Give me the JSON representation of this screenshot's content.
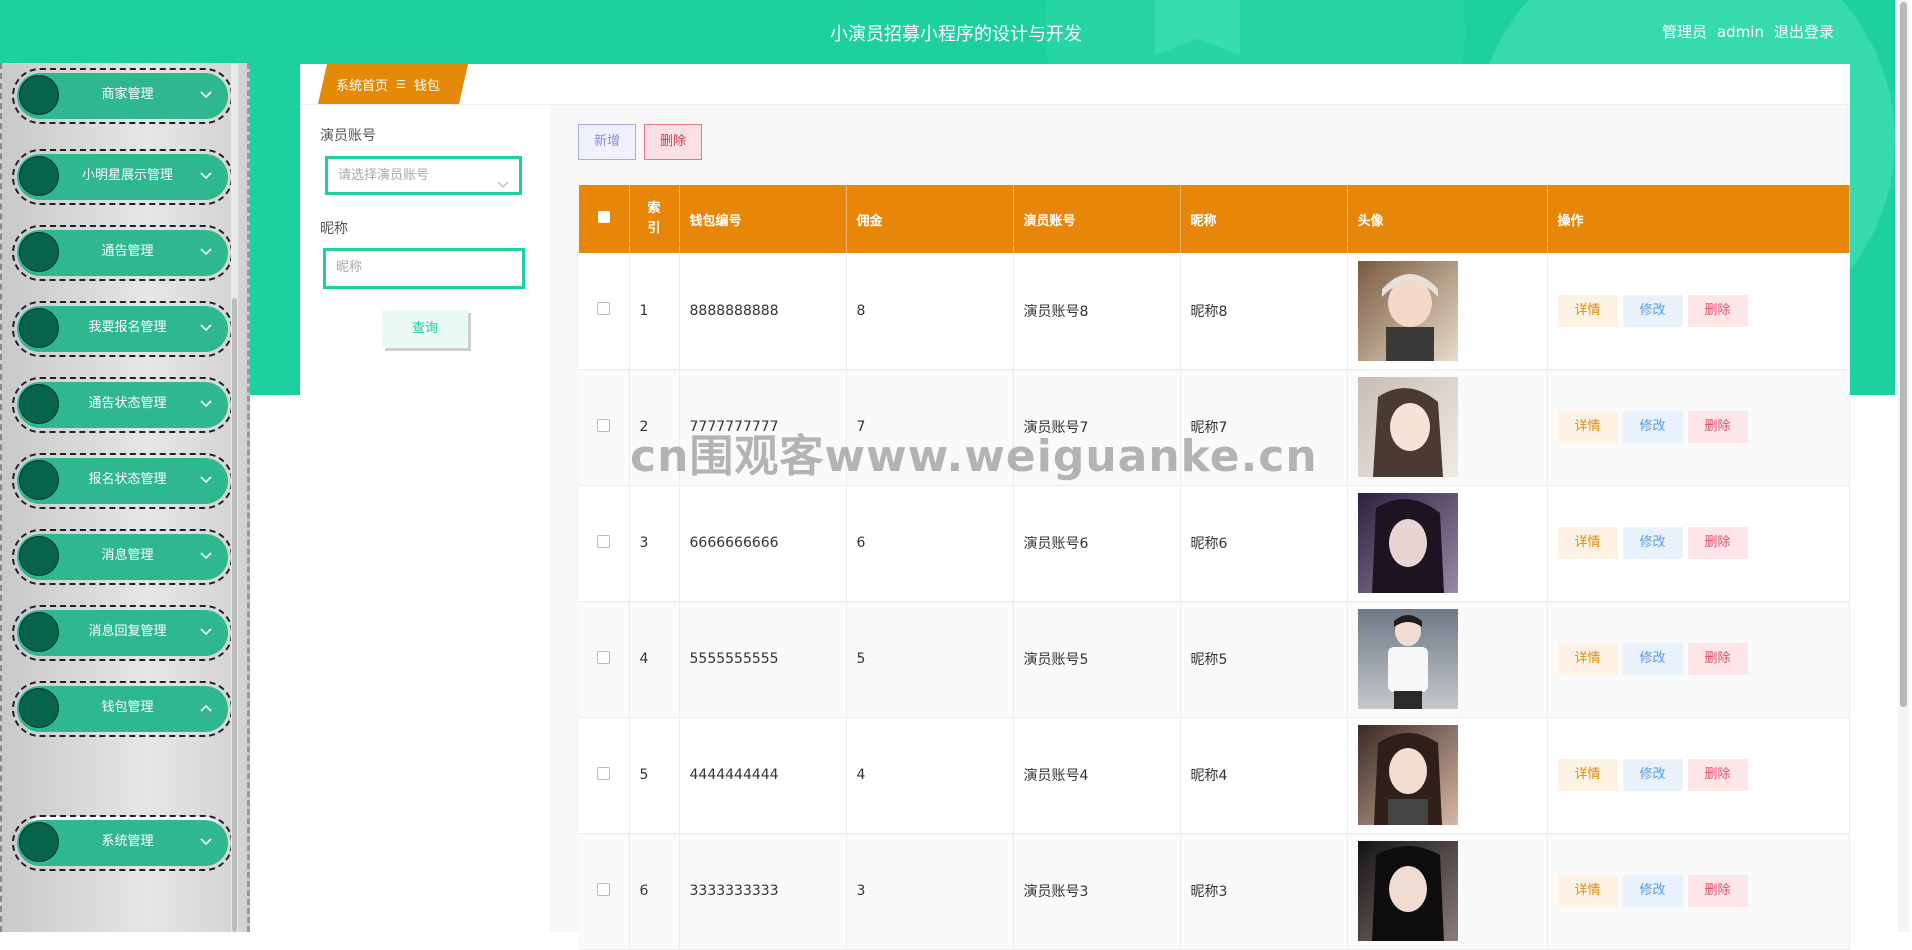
{
  "header": {
    "title": "小演员招募小程序的设计与开发",
    "role": "管理员",
    "username": "admin",
    "logout": "退出登录"
  },
  "sidebar": {
    "items": [
      {
        "label": "商家管理",
        "chevron": "chevron-down-icon"
      },
      {
        "label": "小明星展示管理",
        "chevron": "chevron-down-icon"
      },
      {
        "label": "通告管理",
        "chevron": "chevron-down-icon"
      },
      {
        "label": "我要报名管理",
        "chevron": "chevron-down-icon"
      },
      {
        "label": "通告状态管理",
        "chevron": "chevron-down-icon"
      },
      {
        "label": "报名状态管理",
        "chevron": "chevron-down-icon"
      },
      {
        "label": "消息管理",
        "chevron": "chevron-down-icon"
      },
      {
        "label": "消息回复管理",
        "chevron": "chevron-down-icon"
      },
      {
        "label": "钱包管理",
        "chevron": "chevron-up-icon"
      },
      {
        "label": "系统管理",
        "chevron": "chevron-down-icon"
      }
    ],
    "active_sub": "钱包"
  },
  "breadcrumb": {
    "home": "系统首页",
    "sep": "☰",
    "current": "钱包"
  },
  "filter": {
    "account_label": "演员账号",
    "account_placeholder": "请选择演员账号",
    "nickname_label": "昵称",
    "nickname_placeholder": "昵称",
    "query_button": "查询"
  },
  "toolbar": {
    "add": "新增",
    "delete": "删除"
  },
  "table": {
    "columns": [
      "索引",
      "钱包编号",
      "佣金",
      "演员账号",
      "昵称",
      "头像",
      "操作"
    ],
    "rows": [
      {
        "index": "1",
        "wallet_no": "8888888888",
        "commission": "8",
        "account": "演员账号8",
        "nickname": "昵称8"
      },
      {
        "index": "2",
        "wallet_no": "7777777777",
        "commission": "7",
        "account": "演员账号7",
        "nickname": "昵称7"
      },
      {
        "index": "3",
        "wallet_no": "6666666666",
        "commission": "6",
        "account": "演员账号6",
        "nickname": "昵称6"
      },
      {
        "index": "4",
        "wallet_no": "5555555555",
        "commission": "5",
        "account": "演员账号5",
        "nickname": "昵称5"
      },
      {
        "index": "5",
        "wallet_no": "4444444444",
        "commission": "4",
        "account": "演员账号4",
        "nickname": "昵称4"
      },
      {
        "index": "6",
        "wallet_no": "3333333333",
        "commission": "3",
        "account": "演员账号3",
        "nickname": "昵称3"
      }
    ],
    "actions": {
      "detail": "详情",
      "edit": "修改",
      "delete": "删除"
    }
  },
  "watermark": "cn围观客www.weiguanke.cn",
  "colors": {
    "header": "#1ecfa0",
    "table_head": "#e8860a",
    "menu_pill": "#2fb88f"
  }
}
